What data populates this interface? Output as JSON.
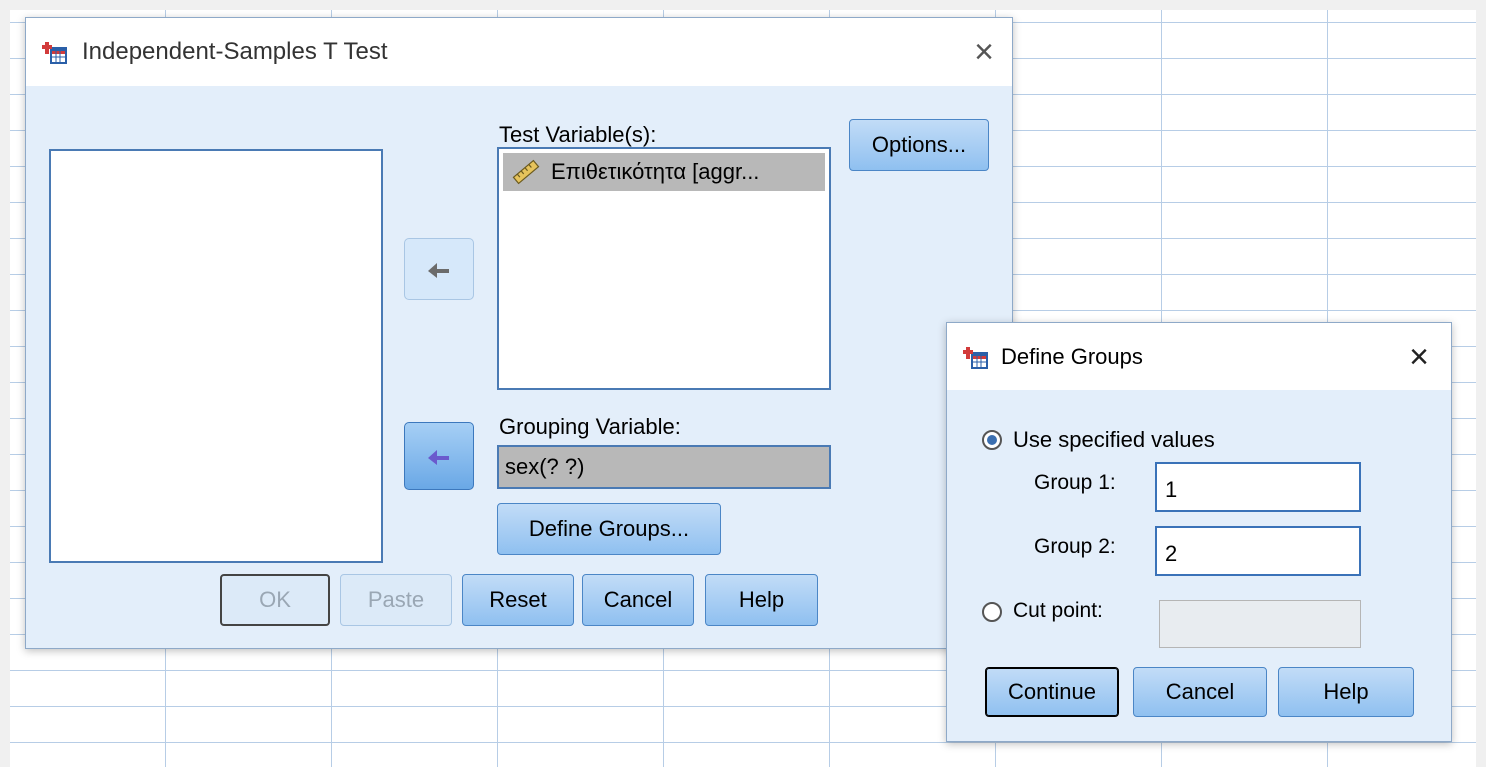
{
  "main_dialog": {
    "title": "Independent-Samples T Test",
    "close_icon": "×",
    "test_variables_label": "Test Variable(s):",
    "test_variables": [
      "Επιθετικότητα [aggr..."
    ],
    "grouping_variable_label": "Grouping Variable:",
    "grouping_variable_value": "sex(? ?)",
    "buttons": {
      "options": "Options...",
      "define_groups": "Define Groups...",
      "ok": "OK",
      "paste": "Paste",
      "reset": "Reset",
      "cancel": "Cancel",
      "help": "Help"
    }
  },
  "define_groups_dialog": {
    "title": "Define Groups",
    "close_icon": "×",
    "use_specified_values_label": "Use specified values",
    "group1_label": "Group 1:",
    "group1_value": "1",
    "group2_label": "Group 2:",
    "group2_value": "2",
    "cut_point_label": "Cut point:",
    "cut_point_value": "",
    "selected_option": "use_specified_values",
    "buttons": {
      "continue": "Continue",
      "cancel": "Cancel",
      "help": "Help"
    }
  },
  "colors": {
    "dialog_bg": "#e3eefa",
    "button_top": "#c2dcf7",
    "button_bottom": "#8fc0f0",
    "border_blue": "#4a7ab4",
    "selection_gray": "#b8b8b8",
    "arrow_active": "#6a5acd"
  }
}
